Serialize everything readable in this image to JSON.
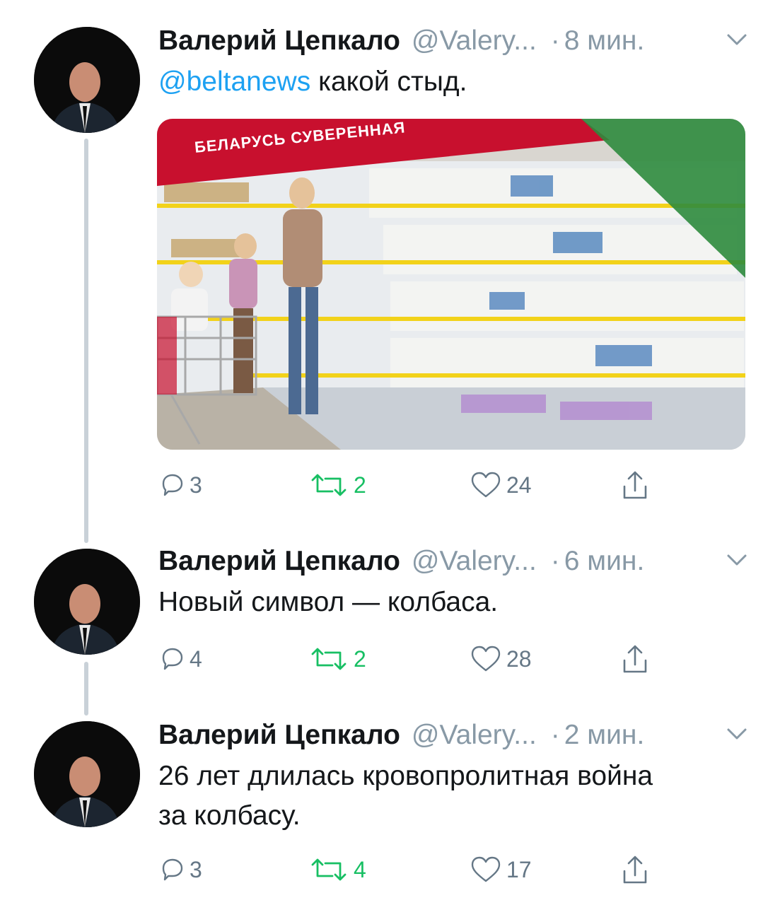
{
  "tweets": [
    {
      "name": "Валерий Цепкало",
      "handle": "@Valery...",
      "dot": "·",
      "time": "8 мин.",
      "mention": "@beltanews",
      "text": "какой стыд.",
      "media": {
        "banner": "БЕЛАРУСЬ СУВЕРЕННАЯ"
      },
      "replies": "3",
      "retweets": "2",
      "likes": "24"
    },
    {
      "name": "Валерий Цепкало",
      "handle": "@Valery...",
      "dot": "·",
      "time": "6 мин.",
      "text": "Новый символ — колбаса.",
      "replies": "4",
      "retweets": "2",
      "likes": "28"
    },
    {
      "name": "Валерий Цепкало",
      "handle": "@Valery...",
      "dot": "·",
      "time": "2 мин.",
      "text_line1": "26 лет длилась кровопролитная война",
      "text_line2": "за колбасу.",
      "replies": "3",
      "retweets": "4",
      "likes": "17"
    }
  ],
  "colors": {
    "link": "#1da1f2",
    "retweet": "#17bf63",
    "muted": "#8899a6",
    "thread_line": "#c9d1d8",
    "banner_red": "#c8102e",
    "banner_green": "#2e8b3d"
  },
  "icons": [
    "reply-icon",
    "retweet-icon",
    "like-icon",
    "share-icon",
    "chevron-down-icon"
  ]
}
